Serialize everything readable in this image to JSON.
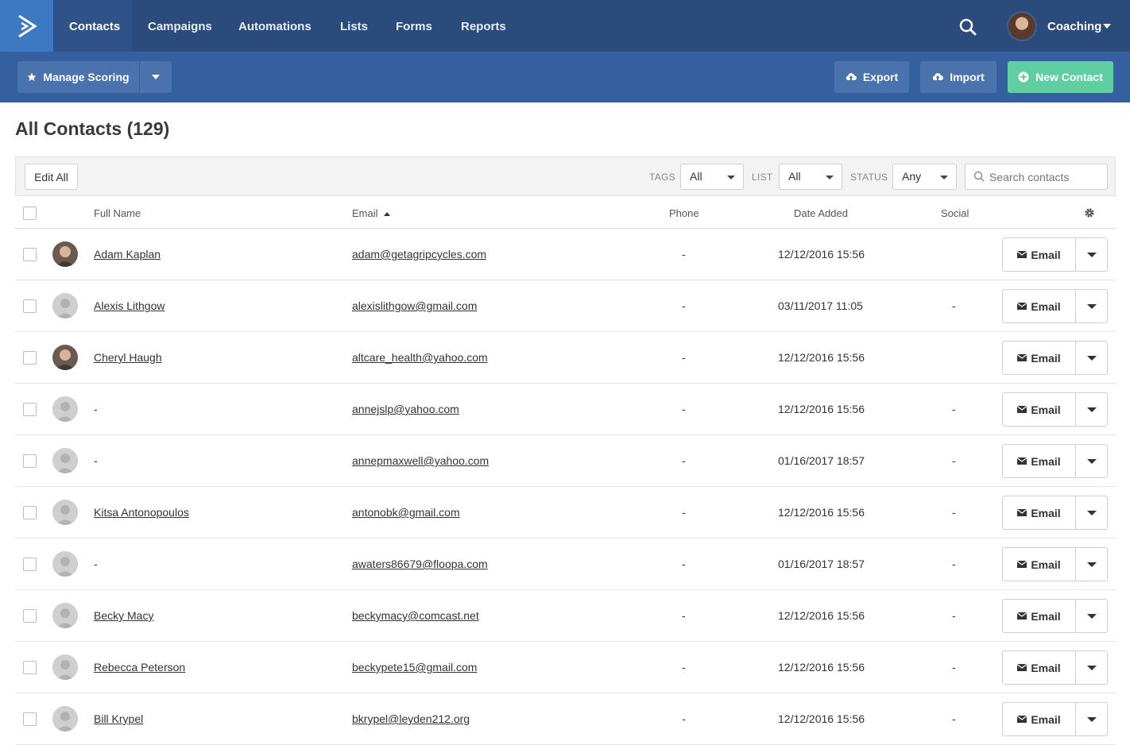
{
  "nav": {
    "tabs": [
      {
        "label": "Contacts",
        "active": true
      },
      {
        "label": "Campaigns"
      },
      {
        "label": "Automations"
      },
      {
        "label": "Lists"
      },
      {
        "label": "Forms"
      },
      {
        "label": "Reports"
      }
    ],
    "user": "Coaching",
    "icons": {
      "logo": "activecampaign-chevron-icon",
      "search": "search-icon",
      "caret": "chevron-down-icon"
    }
  },
  "actions": {
    "manage_scoring": "Manage Scoring",
    "export": "Export",
    "import": "Import",
    "new_contact": "New Contact"
  },
  "page": {
    "title": "All Contacts (129)"
  },
  "filters": {
    "edit_all": "Edit All",
    "tags_label": "TAGS",
    "tags_value": "All",
    "list_label": "LIST",
    "list_value": "All",
    "status_label": "STATUS",
    "status_value": "Any",
    "search_placeholder": "Search contacts"
  },
  "table": {
    "columns": [
      "Full Name",
      "Email",
      "Phone",
      "Date Added",
      "Social"
    ],
    "action_label": "Email",
    "rows": [
      {
        "name": "Adam Kaplan",
        "email": "adam@getagripcycles.com",
        "phone": "-",
        "date": "12/12/2016 15:56",
        "social": "",
        "avatar": "photo"
      },
      {
        "name": "Alexis Lithgow",
        "email": "alexislithgow@gmail.com",
        "phone": "-",
        "date": "03/11/2017 11:05",
        "social": "-",
        "avatar": "default"
      },
      {
        "name": "Cheryl Haugh",
        "email": "altcare_health@yahoo.com",
        "phone": "-",
        "date": "12/12/2016 15:56",
        "social": "",
        "avatar": "photo"
      },
      {
        "name": "-",
        "email": "annejslp@yahoo.com",
        "phone": "-",
        "date": "12/12/2016 15:56",
        "social": "-",
        "avatar": "default"
      },
      {
        "name": "-",
        "email": "annepmaxwell@yahoo.com",
        "phone": "-",
        "date": "01/16/2017 18:57",
        "social": "-",
        "avatar": "default"
      },
      {
        "name": "Kitsa Antonopoulos",
        "email": "antonobk@gmail.com",
        "phone": "-",
        "date": "12/12/2016 15:56",
        "social": "-",
        "avatar": "default"
      },
      {
        "name": "-",
        "email": "awaters86679@floopa.com",
        "phone": "-",
        "date": "01/16/2017 18:57",
        "social": "-",
        "avatar": "default"
      },
      {
        "name": "Becky Macy",
        "email": "beckymacy@comcast.net",
        "phone": "-",
        "date": "12/12/2016 15:56",
        "social": "-",
        "avatar": "default"
      },
      {
        "name": "Rebecca Peterson",
        "email": "beckypete15@gmail.com",
        "phone": "-",
        "date": "12/12/2016 15:56",
        "social": "-",
        "avatar": "default"
      },
      {
        "name": "Bill Krypel",
        "email": "bkrypel@leyden212.org",
        "phone": "-",
        "date": "12/12/2016 15:56",
        "social": "-",
        "avatar": "default"
      }
    ]
  },
  "colors": {
    "nav": "#2a4b7c",
    "actionbar": "#3560a0",
    "accent_green": "#5fcfa3"
  }
}
